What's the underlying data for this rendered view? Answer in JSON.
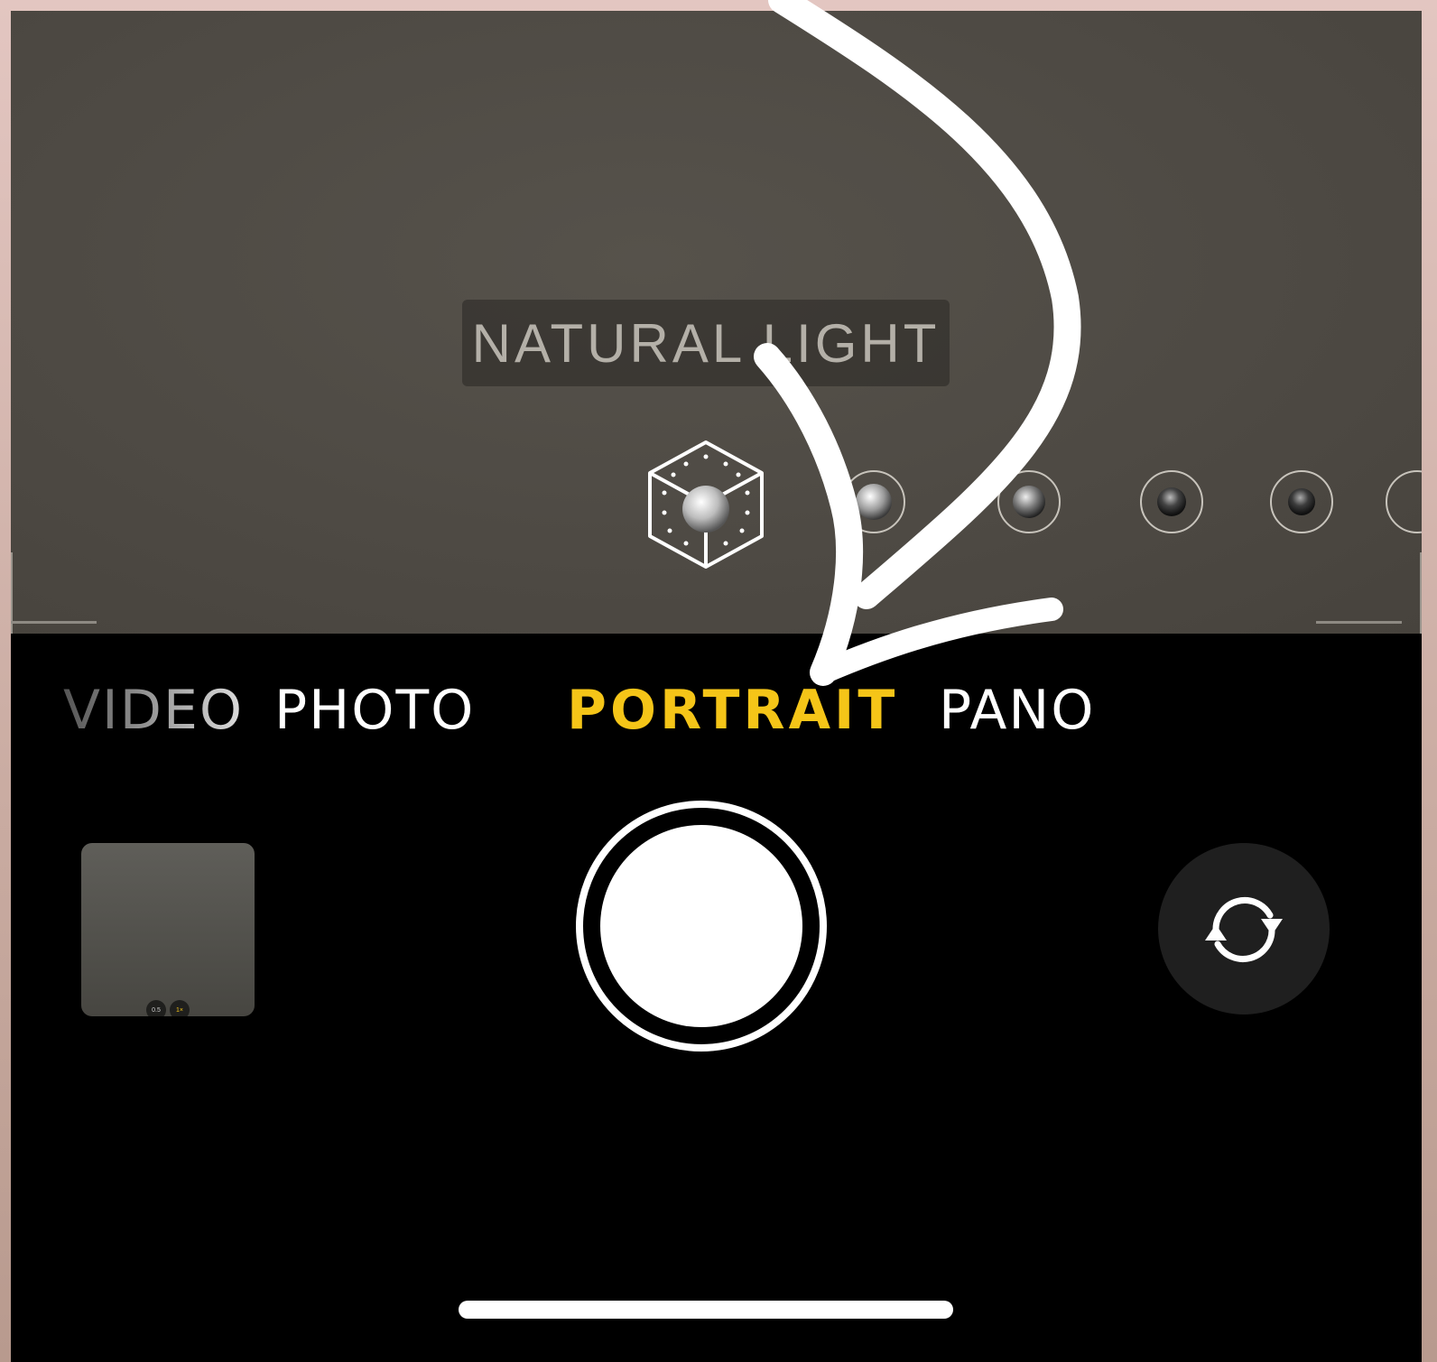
{
  "lighting": {
    "current_label": "NATURAL LIGHT",
    "effects": [
      "natural-light",
      "studio-light",
      "contour-light",
      "stage-light",
      "stage-light-mono",
      "high-key-light-mono"
    ]
  },
  "modes": {
    "items": [
      "VIDEO",
      "PHOTO",
      "PORTRAIT",
      "PANO"
    ],
    "video": "VIDEO",
    "photo": "PHOTO",
    "portrait": "PORTRAIT",
    "pano": "PANO",
    "selected": "PORTRAIT"
  },
  "thumbnail": {
    "chip_left": "0.5",
    "chip_right": "1×"
  },
  "colors": {
    "accent_selected_mode": "#f5c518",
    "background": "#000000",
    "viewfinder": "#4e4a44",
    "frame": "#d9bbb4",
    "annotation_arrow": "#ffffff"
  },
  "icons": {
    "lighting_effect": "light-cube-icon",
    "flip_camera": "camera-flip-icon",
    "shutter": "shutter-button",
    "annotation": "hand-drawn-arrow-icon"
  }
}
